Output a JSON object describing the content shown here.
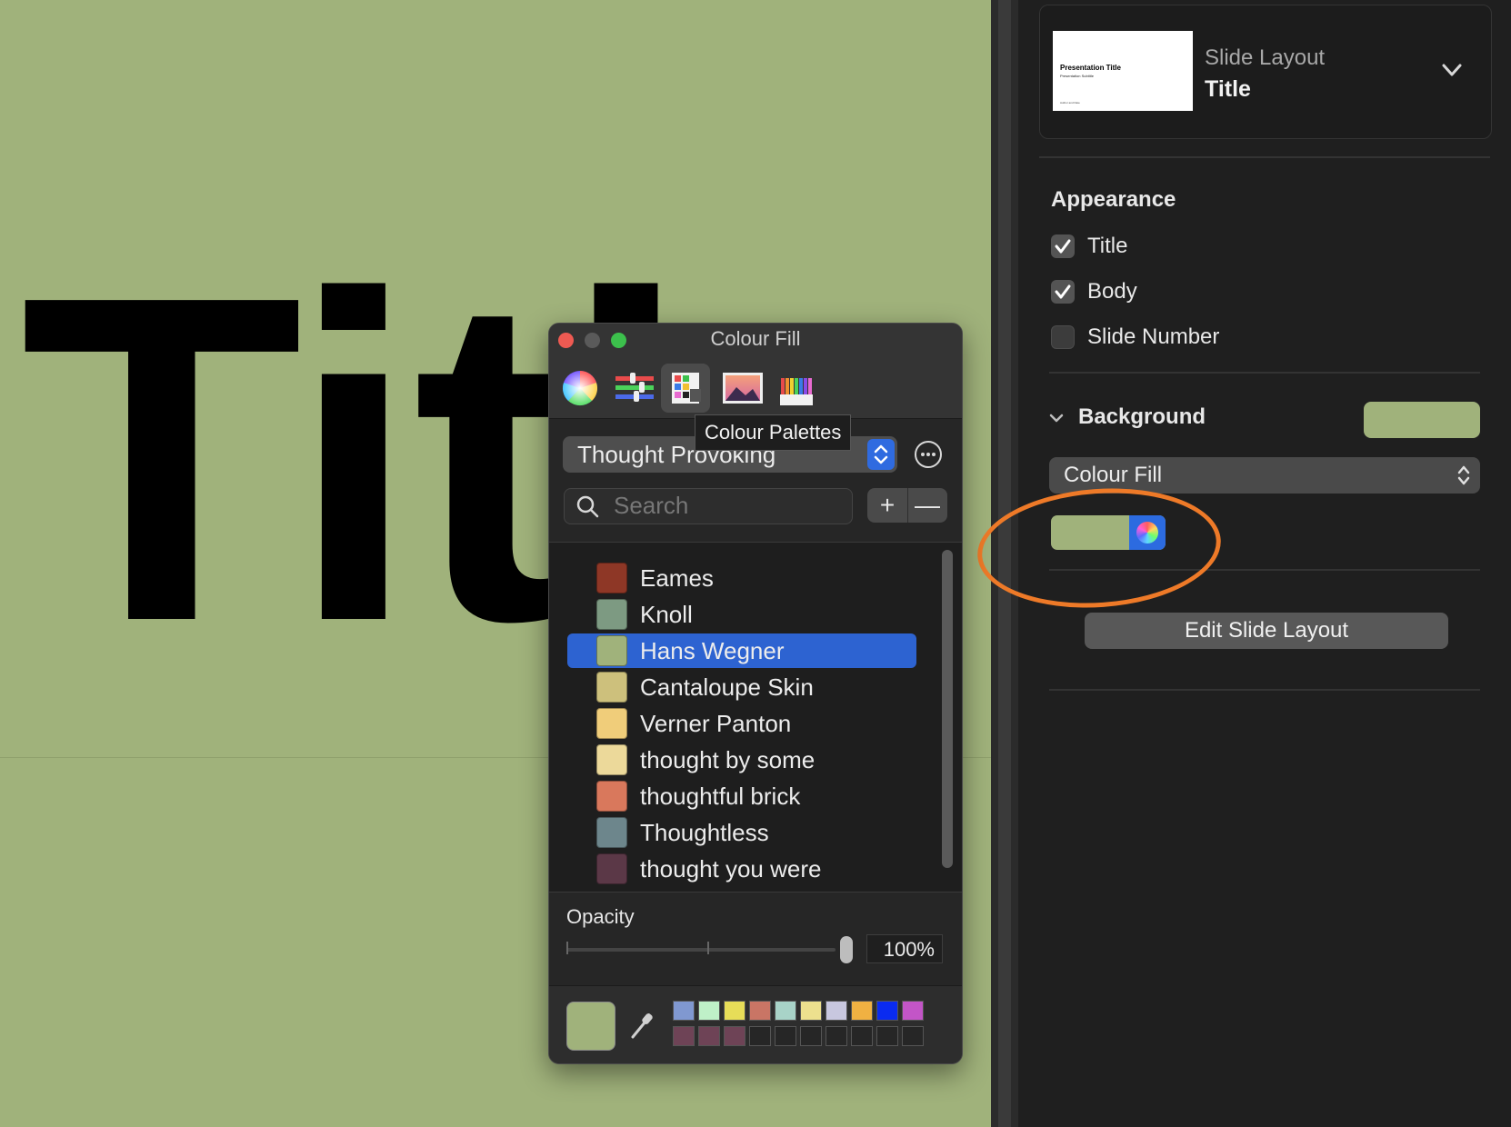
{
  "canvas": {
    "title_text": "Title",
    "background_color": "#a0b27b"
  },
  "sidebar": {
    "slide_layout": {
      "label": "Slide Layout",
      "value": "Title",
      "thumbnail": {
        "title": "Presentation Title",
        "subtitle": "Presentation Subtitle",
        "author": "Author and Date"
      }
    },
    "appearance": {
      "heading": "Appearance",
      "options": [
        {
          "label": "Title",
          "checked": true
        },
        {
          "label": "Body",
          "checked": true
        },
        {
          "label": "Slide Number",
          "checked": false
        }
      ]
    },
    "background": {
      "heading": "Background",
      "swatch_color": "#a0b27b",
      "fill_type": "Colour Fill",
      "colour_well_color": "#a0b27b"
    },
    "edit_layout_button": "Edit Slide Layout",
    "highlight_color": "#ee7a28"
  },
  "colour_panel": {
    "title": "Colour Fill",
    "tools": [
      "colour-wheel-icon",
      "sliders-icon",
      "colour-palettes-icon",
      "image-palette-icon",
      "pencils-icon"
    ],
    "tooltip": "Colour Palettes",
    "palette_name": "Thought Provoking",
    "search_placeholder": "Search",
    "add_label": "+",
    "remove_label": "—",
    "colours": [
      {
        "name": "Eames",
        "hex": "#8e3726",
        "selected": false
      },
      {
        "name": "Knoll",
        "hex": "#7d9a82",
        "selected": false
      },
      {
        "name": "Hans Wegner",
        "hex": "#a0b27b",
        "selected": true
      },
      {
        "name": "Cantaloupe Skin",
        "hex": "#cdc07c",
        "selected": false
      },
      {
        "name": "Verner Panton",
        "hex": "#f0cd7a",
        "selected": false
      },
      {
        "name": "thought by some",
        "hex": "#ecd99a",
        "selected": false
      },
      {
        "name": "thoughtful brick",
        "hex": "#d9785c",
        "selected": false
      },
      {
        "name": "Thoughtless",
        "hex": "#6d868c",
        "selected": false
      },
      {
        "name": "thought you were",
        "hex": "#5b3847",
        "selected": false
      }
    ],
    "opacity_label": "Opacity",
    "opacity_value": "100%",
    "current_color": "#a0b27b",
    "swatches_row1": [
      "#8098d0",
      "#bff0c8",
      "#e7dd58",
      "#c97565",
      "#a8d3c8",
      "#ede08e",
      "#c8c7df",
      "#f0b142",
      "#0a2bf0",
      "#c355c7"
    ],
    "swatches_row2": [
      "#6e4356",
      "#6e4356",
      "#6e4356",
      "",
      "",
      "",
      "",
      "",
      "",
      ""
    ]
  }
}
